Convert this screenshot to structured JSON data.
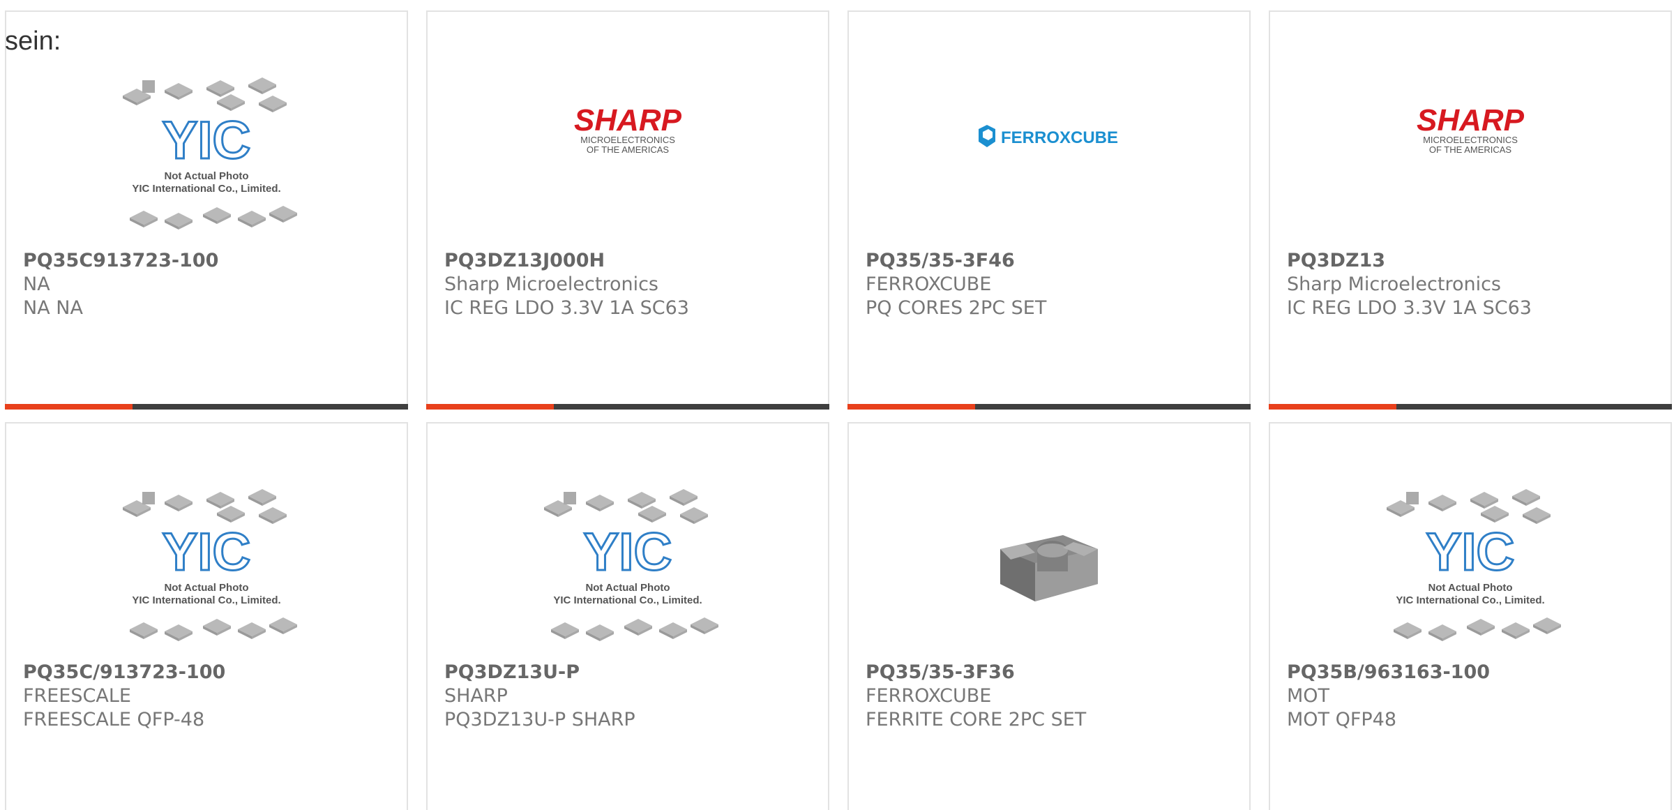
{
  "colors": {
    "accent": "#e8401c",
    "dark": "#3f3f3f",
    "sharp_red": "#d71920",
    "ferro_blue": "#1b8fd0",
    "yic_blue": "#2f7fc7"
  },
  "intro_text": "sein:",
  "placeholder": {
    "caption_line1": "Not Actual Photo",
    "caption_line2": "YIC International Co., Limited.",
    "logo_text": "YIC"
  },
  "sharp_logo": {
    "word": "SHARP",
    "sub1": "MICROELECTRONICS",
    "sub2": "OF THE AMERICAS"
  },
  "ferroxcube_logo": {
    "word": "FERROXCUBE"
  },
  "products": [
    {
      "part": "PQ35C913723-100",
      "maker": "NA",
      "desc": "NA NA",
      "image": "placeholder-icon"
    },
    {
      "part": "PQ3DZ13J000H",
      "maker": "Sharp Microelectronics",
      "desc": "IC REG LDO 3.3V 1A SC63",
      "image": "sharp-logo"
    },
    {
      "part": "PQ35/35-3F46",
      "maker": "FERROXCUBE",
      "desc": "PQ CORES 2PC SET",
      "image": "ferroxcube-logo"
    },
    {
      "part": "PQ3DZ13",
      "maker": "Sharp Microelectronics",
      "desc": "IC REG LDO 3.3V 1A SC63",
      "image": "sharp-logo"
    },
    {
      "part": "PQ35C/913723-100",
      "maker": "FREESCALE",
      "desc": "FREESCALE QFP-48",
      "image": "placeholder-icon"
    },
    {
      "part": "PQ3DZ13U-P",
      "maker": "SHARP",
      "desc": "PQ3DZ13U-P SHARP",
      "image": "placeholder-icon"
    },
    {
      "part": "PQ35/35-3F36",
      "maker": "FERROXCUBE",
      "desc": "FERRITE CORE 2PC SET",
      "image": "ferrite-core-photo"
    },
    {
      "part": "PQ35B/963163-100",
      "maker": "MOT",
      "desc": "MOT QFP48",
      "image": "placeholder-icon"
    }
  ]
}
